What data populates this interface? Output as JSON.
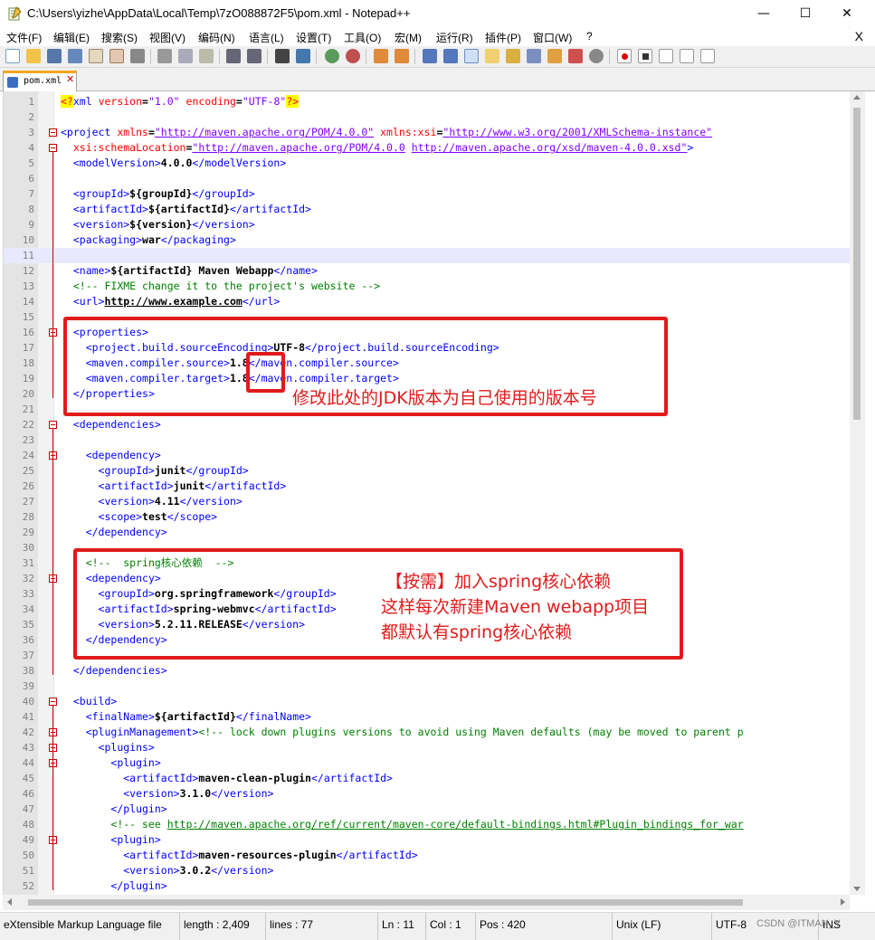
{
  "window": {
    "title": "C:\\Users\\yizhe\\AppData\\Local\\Temp\\7zO088872F5\\pom.xml - Notepad++",
    "minimize": "—",
    "maximize": "☐",
    "close": "✕"
  },
  "menu": {
    "items": [
      "文件(F)",
      "编辑(E)",
      "搜索(S)",
      "视图(V)",
      "编码(N)",
      "语言(L)",
      "设置(T)",
      "工具(O)",
      "宏(M)",
      "运行(R)",
      "插件(P)",
      "窗口(W)",
      "?"
    ],
    "close": "X"
  },
  "toolbar": {
    "icons": [
      "new-file-icon",
      "open-file-icon",
      "save-icon",
      "save-all-icon",
      "close-icon",
      "close-all-icon",
      "print-icon",
      "cut-icon",
      "copy-icon",
      "paste-icon",
      "undo-icon",
      "redo-icon",
      "find-icon",
      "replace-icon",
      "zoom-in-icon",
      "zoom-out-icon",
      "sync-v-icon",
      "sync-h-icon",
      "wrap-icon",
      "show-all-icon",
      "indent-guide-icon",
      "udl-icon",
      "doc-map-icon",
      "function-list-icon",
      "folder-workspace-icon",
      "monitor-icon",
      "record-macro-icon",
      "stop-macro-icon",
      "play-macro-icon",
      "run-macro-multi-icon",
      "save-macro-icon"
    ]
  },
  "tab": {
    "label": "pom.xml"
  },
  "editor": {
    "current_line": 11,
    "lines": [
      {
        "n": "1"
      },
      {
        "n": "2"
      },
      {
        "n": "3"
      },
      {
        "n": "4"
      },
      {
        "n": "5"
      },
      {
        "n": "6"
      },
      {
        "n": "7"
      },
      {
        "n": "8"
      },
      {
        "n": "9"
      },
      {
        "n": "10"
      },
      {
        "n": "11"
      },
      {
        "n": "12"
      },
      {
        "n": "13"
      },
      {
        "n": "14"
      },
      {
        "n": "15"
      },
      {
        "n": "16"
      },
      {
        "n": "17"
      },
      {
        "n": "18"
      },
      {
        "n": "19"
      },
      {
        "n": "20"
      },
      {
        "n": "21"
      },
      {
        "n": "22"
      },
      {
        "n": "23"
      },
      {
        "n": "24"
      },
      {
        "n": "25"
      },
      {
        "n": "26"
      },
      {
        "n": "27"
      },
      {
        "n": "28"
      },
      {
        "n": "29"
      },
      {
        "n": "30"
      },
      {
        "n": "31"
      },
      {
        "n": "32"
      },
      {
        "n": "33"
      },
      {
        "n": "34"
      },
      {
        "n": "35"
      },
      {
        "n": "36"
      },
      {
        "n": "37"
      },
      {
        "n": "38"
      },
      {
        "n": "39"
      },
      {
        "n": "40"
      },
      {
        "n": "41"
      },
      {
        "n": "42"
      },
      {
        "n": "43"
      },
      {
        "n": "44"
      },
      {
        "n": "45"
      },
      {
        "n": "46"
      },
      {
        "n": "47"
      },
      {
        "n": "48"
      },
      {
        "n": "49"
      },
      {
        "n": "50"
      },
      {
        "n": "51"
      },
      {
        "n": "52"
      }
    ],
    "code": {
      "l1_pi_open": "<?",
      "l1_name": "xml",
      "l1_a1": " version",
      "l1_eq1": "=",
      "l1_v1": "\"1.0\"",
      "l1_a2": " encoding",
      "l1_eq2": "=",
      "l1_v2": "\"UTF-8\"",
      "l1_pi_close": "?>",
      "l3_tag": "<project",
      "l3_a1": " xmlns",
      "l3_v1": "\"http://maven.apache.org/POM/4.0.0\"",
      "l3_a2": " xmlns:xsi",
      "l3_v2": "\"http://www.w3.org/2001/XMLSchema-instance\"",
      "l4_a": "  xsi:schemaLocation",
      "l4_v1": "\"http://maven.apache.org/POM/4.0.0",
      "l4_v2": "http://maven.apache.org/xsd/maven-4.0.0.xsd\"",
      "l4_close": ">",
      "l5": {
        "open": "<modelVersion>",
        "text": "4.0.0",
        "close": "</modelVersion>"
      },
      "l7": {
        "open": "<groupId>",
        "text": "${groupId}",
        "close": "</groupId>"
      },
      "l8": {
        "open": "<artifactId>",
        "text": "${artifactId}",
        "close": "</artifactId>"
      },
      "l9": {
        "open": "<version>",
        "text": "${version}",
        "close": "</version>"
      },
      "l10": {
        "open": "<packaging>",
        "text": "war",
        "close": "</packaging>"
      },
      "l12": {
        "open": "<name>",
        "text": "${artifactId} Maven Webapp",
        "close": "</name>"
      },
      "l13": "<!-- FIXME change it to the project's website -->",
      "l14": {
        "open": "<url>",
        "text": "http://www.example.com",
        "close": "</url>"
      },
      "l16": "<properties>",
      "l17": {
        "open": "<project.build.sourceEncoding>",
        "text": "UTF-8",
        "close": "</project.build.sourceEncoding>"
      },
      "l18": {
        "open": "<maven.compiler.source>",
        "text": "1.8",
        "close": "</maven.compiler.source>"
      },
      "l19": {
        "open": "<maven.compiler.target>",
        "text": "1.8",
        "close": "</maven.compiler.target>"
      },
      "l20": "</properties>",
      "l22": "<dependencies>",
      "l24": "<dependency>",
      "l25": {
        "open": "<groupId>",
        "text": "junit",
        "close": "</groupId>"
      },
      "l26": {
        "open": "<artifactId>",
        "text": "junit",
        "close": "</artifactId>"
      },
      "l27": {
        "open": "<version>",
        "text": "4.11",
        "close": "</version>"
      },
      "l28": {
        "open": "<scope>",
        "text": "test",
        "close": "</scope>"
      },
      "l29": "</dependency>",
      "l31": "<!--  spring核心依赖  -->",
      "l32": "<dependency>",
      "l33": {
        "open": "<groupId>",
        "text": "org.springframework",
        "close": "</groupId>"
      },
      "l34": {
        "open": "<artifactId>",
        "text": "spring-webmvc",
        "close": "</artifactId>"
      },
      "l35": {
        "open": "<version>",
        "text": "5.2.11.RELEASE",
        "close": "</version>"
      },
      "l36": "</dependency>",
      "l38": "</dependencies>",
      "l40": "<build>",
      "l41": {
        "open": "<finalName>",
        "text": "${artifactId}",
        "close": "</finalName>"
      },
      "l42_tag": "<pluginManagement>",
      "l42_c": "<!-- lock down plugins versions to avoid using Maven defaults (may be moved to parent p",
      "l43": "<plugins>",
      "l44": "<plugin>",
      "l45": {
        "open": "<artifactId>",
        "text": "maven-clean-plugin",
        "close": "</artifactId>"
      },
      "l46": {
        "open": "<version>",
        "text": "3.1.0",
        "close": "</version>"
      },
      "l47": "</plugin>",
      "l48_c1": "<!-- see ",
      "l48_c2": "http://maven.apache.org/ref/current/maven-core/default-bindings.html#Plugin_bindings_for_war",
      "l49": "<plugin>",
      "l50": {
        "open": "<artifactId>",
        "text": "maven-resources-plugin",
        "close": "</artifactId>"
      },
      "l51": {
        "open": "<version>",
        "text": "3.0.2",
        "close": "</version>"
      },
      "l52": "</plugin>"
    }
  },
  "annotations": {
    "jdk_note": "修改此处的JDK版本为自己使用的版本号",
    "spring_note_1": "【按需】加入spring核心依赖",
    "spring_note_2": "这样每次新建Maven webapp项目",
    "spring_note_3": "都默认有spring核心依赖",
    "color": "#e01b1b"
  },
  "status": {
    "lang": "eXtensible Markup Language file",
    "length": "length : 2,409",
    "lines": "lines : 77",
    "ln": "Ln : 11",
    "col": "Col : 1",
    "pos": "Pos : 420",
    "eol": "Unix (LF)",
    "encoding": "UTF-8",
    "ins": "INS",
    "watermark": "CSDN @ITMAN_Y"
  }
}
